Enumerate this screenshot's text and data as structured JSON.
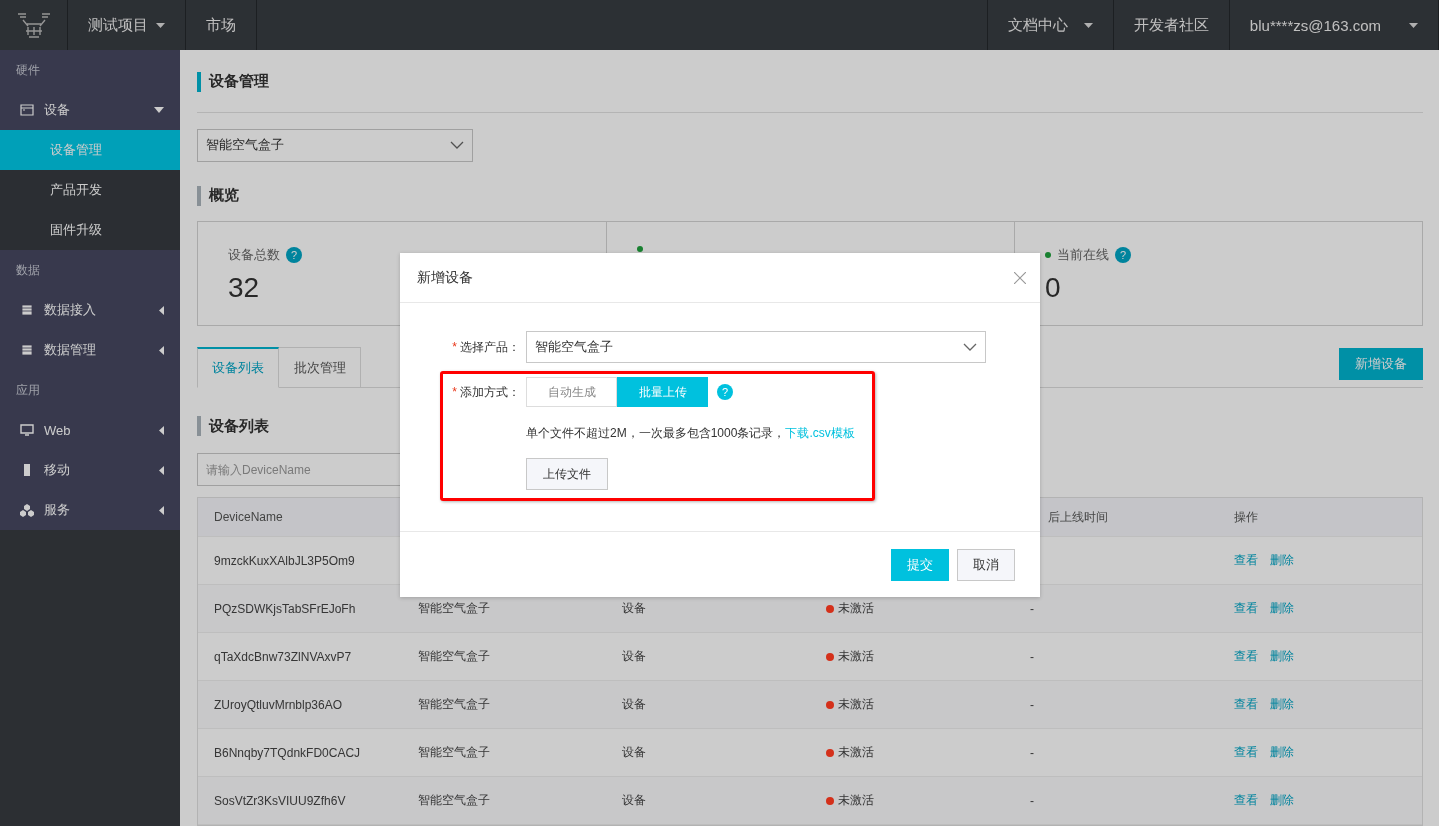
{
  "topbar": {
    "project": {
      "label": "测试项目",
      "dropdown": true
    },
    "nav": [
      {
        "label": "市场",
        "dropdown": false
      }
    ],
    "right": [
      {
        "label": "文档中心",
        "dropdown": true
      },
      {
        "label": "开发者社区",
        "dropdown": false
      },
      {
        "label": "blu****zs@163.com",
        "dropdown": true
      }
    ]
  },
  "sidebar": {
    "sections": [
      {
        "label": "硬件",
        "items": [
          {
            "label": "设备",
            "kind": "window",
            "expanded": true,
            "children": [
              {
                "label": "设备管理",
                "selected": true
              },
              {
                "label": "产品开发",
                "selected": false
              },
              {
                "label": "固件升级",
                "selected": false
              }
            ]
          }
        ]
      },
      {
        "label": "数据",
        "items": [
          {
            "label": "数据接入",
            "kind": "doc",
            "expanded": false
          },
          {
            "label": "数据管理",
            "kind": "doc",
            "expanded": false
          }
        ]
      },
      {
        "label": "应用",
        "items": [
          {
            "label": "Web",
            "kind": "monitor",
            "expanded": false
          },
          {
            "label": "移动",
            "kind": "phone",
            "expanded": false
          },
          {
            "label": "服务",
            "kind": "cubes",
            "expanded": false
          }
        ]
      }
    ]
  },
  "page_title": "设备管理",
  "product_select": {
    "value": "智能空气盒子"
  },
  "overview": {
    "title": "概览",
    "cards": [
      {
        "label": "设备总数",
        "dot": false,
        "help": "?",
        "value": "32"
      },
      {
        "dot": true
      },
      {
        "label": "当前在线",
        "dot": true,
        "help": "?",
        "value": "0"
      }
    ]
  },
  "tabs": [
    {
      "label": "设备列表",
      "selected": true
    },
    {
      "label": "批次管理",
      "selected": false
    }
  ],
  "add_button": "新增设备",
  "list_title": "设备列表",
  "search": {
    "placeholder": "请输入DeviceName"
  },
  "table": {
    "header": {
      "device_name": "DeviceName",
      "last_online": "后上线时间",
      "actions": "操作"
    },
    "rows": [
      {
        "device_name": "9mzckKuxXAlbJL3P5Om9",
        "actions": [
          "查看",
          "删除"
        ]
      },
      {
        "device_name": "PQzSDWKjsTabSFrEJoFh",
        "product": "智能空气盒子",
        "type": "设备",
        "status": {
          "label": "未激活",
          "color": "#d4301a"
        },
        "last_online": "-",
        "actions": [
          "查看",
          "删除"
        ]
      },
      {
        "device_name": "qTaXdcBnw73ZlNVAxvP7",
        "product": "智能空气盒子",
        "type": "设备",
        "status": {
          "label": "未激活",
          "color": "#d4301a"
        },
        "last_online": "-",
        "actions": [
          "查看",
          "删除"
        ]
      },
      {
        "device_name": "ZUroyQtluvMrnblp36AO",
        "product": "智能空气盒子",
        "type": "设备",
        "status": {
          "label": "未激活",
          "color": "#d4301a"
        },
        "last_online": "-",
        "actions": [
          "查看",
          "删除"
        ]
      },
      {
        "device_name": "B6Nnqby7TQdnkFD0CACJ",
        "product": "智能空气盒子",
        "type": "设备",
        "status": {
          "label": "未激活",
          "color": "#d4301a"
        },
        "last_online": "-",
        "actions": [
          "查看",
          "删除"
        ]
      },
      {
        "device_name": "SosVtZr3KsVIUU9Zfh6V",
        "product": "智能空气盒子",
        "type": "设备",
        "status": {
          "label": "未激活",
          "color": "#d4301a"
        },
        "last_online": "-",
        "actions": [
          "查看",
          "删除"
        ]
      }
    ]
  },
  "dialog": {
    "title": "新增设备",
    "product": {
      "label": "选择产品：",
      "required_mark": "*",
      "value": "智能空气盒子"
    },
    "method": {
      "label": "添加方式：",
      "required_mark": "*",
      "help": "?",
      "options": [
        {
          "label": "自动生成",
          "selected": false
        },
        {
          "label": "批量上传",
          "selected": true
        }
      ]
    },
    "hint": "单个文件不超过2M，一次最多包含1000条记录，",
    "hint_link": "下载.csv模板",
    "upload_button": "上传文件",
    "buttons": [
      {
        "label": "提交",
        "kind": "primary"
      },
      {
        "label": "取消",
        "kind": "default"
      }
    ]
  }
}
